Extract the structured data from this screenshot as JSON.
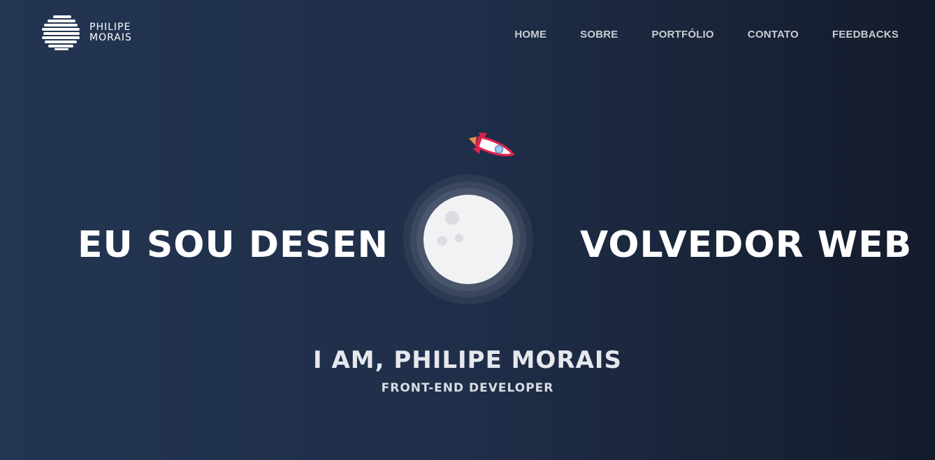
{
  "brand": {
    "line1": "PHILIPE",
    "line2": "MORAIS",
    "icon": "striped-globe-logo"
  },
  "nav": {
    "items": [
      {
        "label": "HOME"
      },
      {
        "label": "SOBRE"
      },
      {
        "label": "PORTFÓLIO"
      },
      {
        "label": "CONTATO"
      },
      {
        "label": "FEEDBACKS"
      }
    ]
  },
  "hero": {
    "left_text": "EU SOU DESEN",
    "right_text": "VOLVEDOR WEB",
    "illustration": {
      "moon_icon": "moon",
      "rocket_icon": "rocket"
    }
  },
  "intro": {
    "greeting": "I AM, PHILIPE MORAIS",
    "role": "FRONT-END DEVELOPER"
  },
  "colors": {
    "background_left": "#233551",
    "background_right": "#141b2b",
    "nav_text": "#c9ccd2",
    "moon": "#f2f2f4",
    "rocket_body": "#e1224f",
    "rocket_flame": "#f08a4b"
  }
}
